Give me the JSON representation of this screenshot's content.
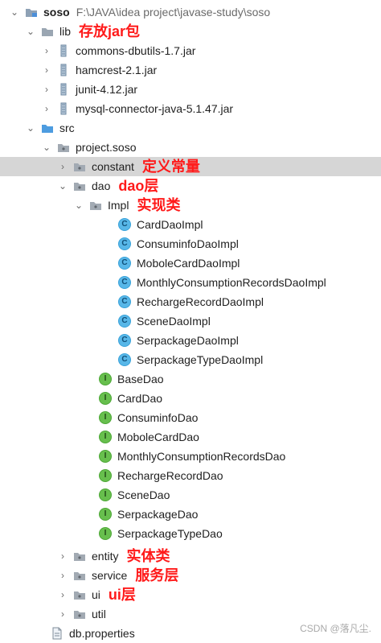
{
  "rows": [
    {
      "name": "soso",
      "path": "F:\\JAVA\\idea project\\javase-study\\soso",
      "annotation": ""
    },
    {
      "name": "lib",
      "annotation": "存放jar包"
    },
    {
      "name": "commons-dbutils-1.7.jar",
      "annotation": ""
    },
    {
      "name": "hamcrest-2.1.jar",
      "annotation": ""
    },
    {
      "name": "junit-4.12.jar",
      "annotation": ""
    },
    {
      "name": "mysql-connector-java-5.1.47.jar",
      "annotation": ""
    },
    {
      "name": "src",
      "annotation": ""
    },
    {
      "name": "project.soso",
      "annotation": ""
    },
    {
      "name": "constant",
      "annotation": "定义常量"
    },
    {
      "name": "dao",
      "annotation": "dao层"
    },
    {
      "name": "Impl",
      "annotation": "实现类"
    },
    {
      "name": "CardDaoImpl",
      "annotation": ""
    },
    {
      "name": "ConsuminfoDaoImpl",
      "annotation": ""
    },
    {
      "name": "MoboleCardDaoImpl",
      "annotation": ""
    },
    {
      "name": "MonthlyConsumptionRecordsDaoImpl",
      "annotation": ""
    },
    {
      "name": "RechargeRecordDaoImpl",
      "annotation": ""
    },
    {
      "name": "SceneDaoImpl",
      "annotation": ""
    },
    {
      "name": "SerpackageDaoImpl",
      "annotation": ""
    },
    {
      "name": "SerpackageTypeDaoImpl",
      "annotation": ""
    },
    {
      "name": "BaseDao",
      "annotation": ""
    },
    {
      "name": "CardDao",
      "annotation": ""
    },
    {
      "name": "ConsuminfoDao",
      "annotation": ""
    },
    {
      "name": "MoboleCardDao",
      "annotation": ""
    },
    {
      "name": "MonthlyConsumptionRecordsDao",
      "annotation": ""
    },
    {
      "name": "RechargeRecordDao",
      "annotation": ""
    },
    {
      "name": "SceneDao",
      "annotation": ""
    },
    {
      "name": "SerpackageDao",
      "annotation": ""
    },
    {
      "name": "SerpackageTypeDao",
      "annotation": ""
    },
    {
      "name": "entity",
      "annotation": "实体类"
    },
    {
      "name": "service",
      "annotation": "服务层"
    },
    {
      "name": "ui",
      "annotation": "ui层"
    },
    {
      "name": "util",
      "annotation": ""
    },
    {
      "name": "db.properties",
      "annotation": ""
    }
  ],
  "watermark": "CSDN @落凡尘."
}
